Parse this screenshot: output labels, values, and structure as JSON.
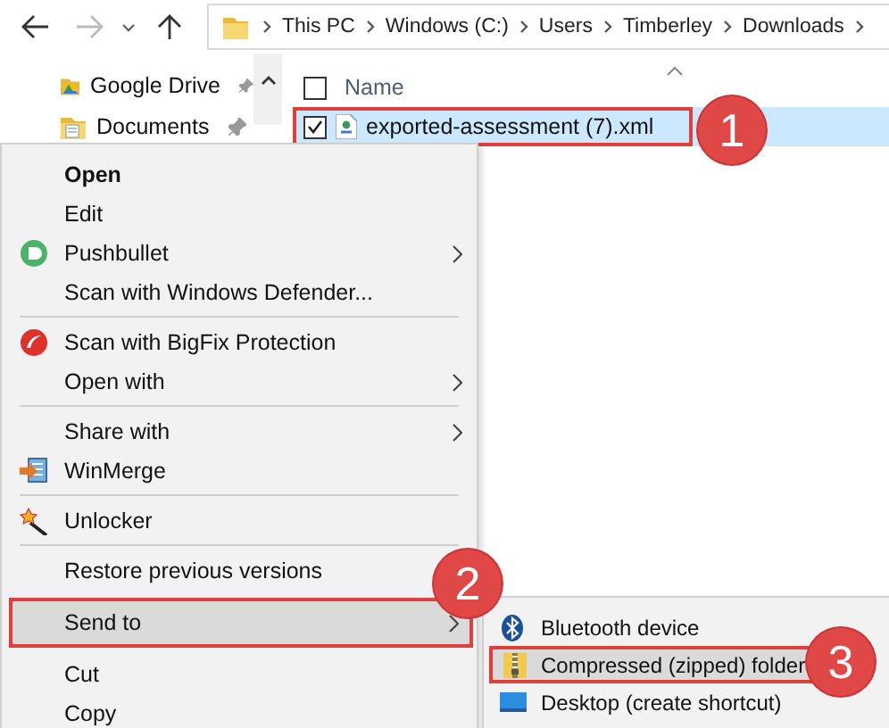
{
  "address_bar": {
    "crumbs": [
      "This PC",
      "Windows (C:)",
      "Users",
      "Timberley",
      "Downloads"
    ]
  },
  "sidebar": {
    "items": [
      {
        "label": "Google Drive"
      },
      {
        "label": "Documents"
      }
    ]
  },
  "file_list": {
    "select_all": {
      "checked": false
    },
    "columns": [
      "Name"
    ],
    "rows": [
      {
        "name": "exported-assessment (7).xml",
        "checked": true,
        "selected": true,
        "outlined": true,
        "callout": "1"
      }
    ]
  },
  "context_menu": {
    "items": [
      {
        "kind": "item",
        "label": "Open",
        "bold": true
      },
      {
        "kind": "item",
        "label": "Edit"
      },
      {
        "kind": "item",
        "label": "Pushbullet",
        "submenu": true
      },
      {
        "kind": "item",
        "label": "Scan with Windows Defender..."
      },
      {
        "kind": "separator"
      },
      {
        "kind": "item",
        "label": "Scan with BigFix Protection"
      },
      {
        "kind": "item",
        "label": "Open with",
        "submenu": true
      },
      {
        "kind": "separator"
      },
      {
        "kind": "item",
        "label": "Share with",
        "submenu": true
      },
      {
        "kind": "item",
        "label": "WinMerge"
      },
      {
        "kind": "separator"
      },
      {
        "kind": "item",
        "label": "Unlocker"
      },
      {
        "kind": "separator"
      },
      {
        "kind": "item",
        "label": "Restore previous versions"
      },
      {
        "kind": "item",
        "label": "Send to",
        "submenu": true,
        "selected": true,
        "outlined": true,
        "callout": "2"
      },
      {
        "kind": "item",
        "label": "Cut"
      },
      {
        "kind": "item",
        "label": "Copy"
      }
    ]
  },
  "send_to_menu": {
    "items": [
      {
        "label": "Bluetooth device",
        "selected": false
      },
      {
        "label": "Compressed (zipped) folder",
        "selected": true,
        "outlined": true,
        "callout": "3"
      },
      {
        "label": "Desktop (create shortcut)",
        "selected": false
      }
    ]
  }
}
